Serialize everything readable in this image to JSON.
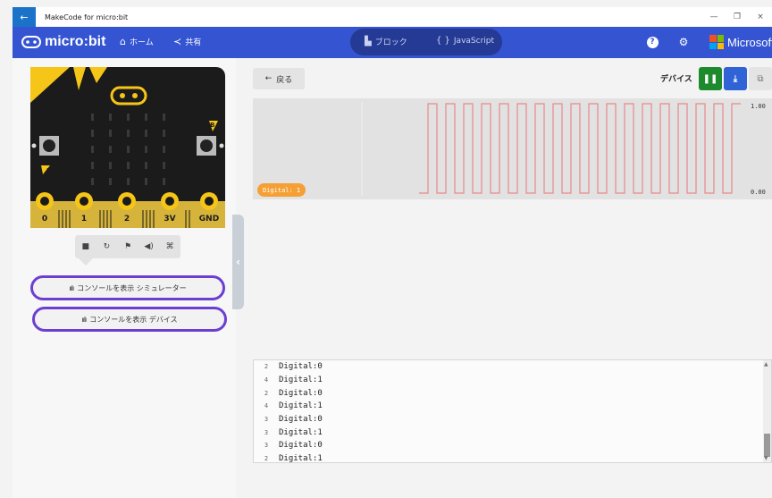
{
  "window": {
    "title": "MakeCode for micro:bit",
    "back_glyph": "←",
    "controls": [
      "—",
      "❐",
      "×"
    ]
  },
  "header": {
    "logo": "micro:bit",
    "home_label": "ホーム",
    "share_label": "共有",
    "blocks_label": "ブロック",
    "js_label": "JavaScript",
    "microsoft": "Microsoft",
    "accent": "#3454d1"
  },
  "board": {
    "pins": [
      "0",
      "1",
      "2",
      "3V",
      "GND"
    ],
    "button_a": "A",
    "button_b": "B"
  },
  "sim_toolbar": {
    "icons": [
      "stop-icon",
      "restart-icon",
      "debug-icon",
      "mute-icon",
      "fullscreen-icon"
    ],
    "glyphs": [
      "■",
      "↻",
      "⚑",
      "◀)",
      "⌘"
    ]
  },
  "console_buttons": {
    "simulator": "コンソールを表示  シミュレーター",
    "device": "コンソールを表示  デバイス",
    "chart_glyph": "ıılı"
  },
  "main": {
    "back_label": "戻る",
    "device_label": "デバイス",
    "pause_glyph": "❚❚",
    "download_glyph": "⤓",
    "copy_glyph": "⧉"
  },
  "chart_data": {
    "type": "line",
    "series": [
      {
        "name": "Digital: 1",
        "color": "#e8888a",
        "values": [
          0,
          1,
          0,
          1,
          0,
          1,
          0,
          1,
          0,
          1,
          0,
          1,
          0,
          1,
          0,
          1,
          0,
          1,
          0,
          1,
          0,
          1,
          0,
          1,
          0,
          1,
          0,
          1,
          0,
          1,
          0,
          1,
          0,
          1,
          0,
          1
        ]
      }
    ],
    "ylim": [
      0,
      1
    ],
    "y_max_label": "1.00",
    "y_min_label": "0.00",
    "grid": false
  },
  "console": {
    "rows": [
      {
        "count": "2",
        "text": "Digital:0"
      },
      {
        "count": "4",
        "text": "Digital:1"
      },
      {
        "count": "2",
        "text": "Digital:0"
      },
      {
        "count": "4",
        "text": "Digital:1"
      },
      {
        "count": "3",
        "text": "Digital:0"
      },
      {
        "count": "3",
        "text": "Digital:1"
      },
      {
        "count": "3",
        "text": "Digital:0"
      },
      {
        "count": "2",
        "text": "Digital:1"
      }
    ]
  }
}
